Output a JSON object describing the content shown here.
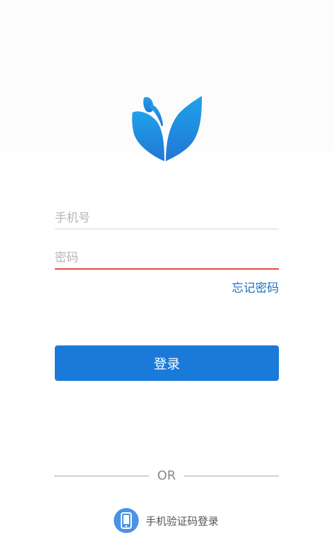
{
  "login": {
    "phone_placeholder": "手机号",
    "password_placeholder": "密码",
    "forgot_password": "忘记密码",
    "login_button": "登录",
    "or_text": "OR",
    "sms_login": "手机验证码登录"
  },
  "icons": {
    "logo": "sprout-leaf-logo",
    "sms": "mobile-phone-icon"
  },
  "colors": {
    "primary": "#1a7ad9",
    "link": "#1d6fbf",
    "error_underline": "#e8473f",
    "sms_icon_bg": "#4a93e6"
  }
}
